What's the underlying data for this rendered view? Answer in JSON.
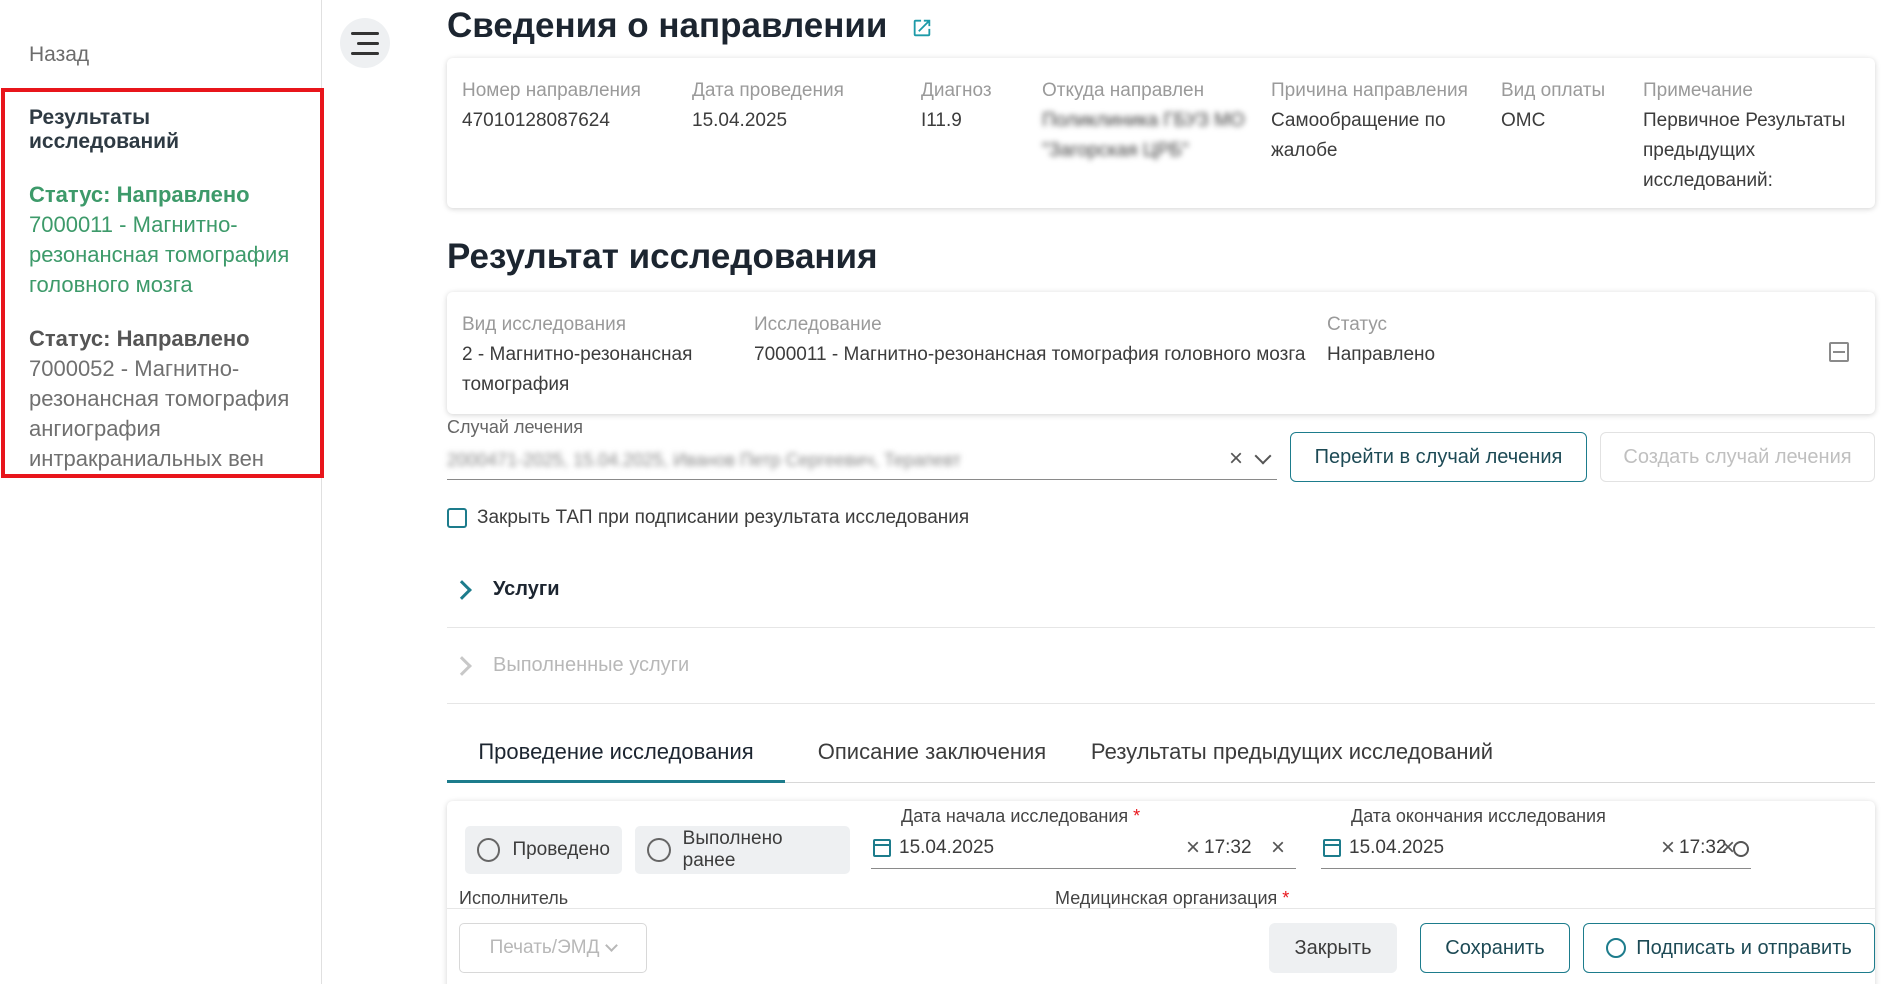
{
  "sidebar": {
    "back_label": "Назад",
    "results_title": "Результаты исследований",
    "items": [
      {
        "status": "Статус: Направлено",
        "name": "7000011 - Магнитно-резонансная томография головного мозга"
      },
      {
        "status": "Статус: Направлено",
        "name": "7000052 - Магнитно-резонансная томография ангиография интракраниальных вен"
      }
    ]
  },
  "referral": {
    "title": "Сведения о направлении",
    "number_label": "Номер направления",
    "number_value": "47010128087624",
    "date_label": "Дата проведения",
    "date_value": "15.04.2025",
    "diagnosis_label": "Диагноз",
    "diagnosis_value": "I11.9",
    "from_label": "Откуда направлен",
    "from_value": "Поликлиника ГБУЗ МО \"Загорская ЦРБ\"",
    "reason_label": "Причина направления",
    "reason_value": "Самообращение по жалобе",
    "payment_label": "Вид оплаты",
    "payment_value": "ОМС",
    "note_label": "Примечание",
    "note_value": "Первичное Результаты предыдущих исследований:"
  },
  "result": {
    "title": "Результат исследования",
    "type_label": "Вид исследования",
    "type_value": "2 - Магнитно-резонансная томография",
    "study_label": "Исследование",
    "study_value": "7000011 - Магнитно-резонансная томография головного мозга",
    "status_label": "Статус",
    "status_value": "Направлено"
  },
  "case": {
    "label": "Случай лечения",
    "value": "2000471-2025, 15.04.2025, Иванов Петр Сергеевич, Терапевт",
    "goto_button": "Перейти в случай лечения",
    "create_button": "Создать случай лечения"
  },
  "close_tap_label": "Закрыть ТАП при подписании результата исследования",
  "sections": {
    "services": "Услуги",
    "done_services": "Выполненные услуги"
  },
  "tabs": [
    "Проведение исследования",
    "Описание заключения",
    "Результаты предыдущих исследований"
  ],
  "conduct": {
    "radio_done": "Проведено",
    "radio_earlier": "Выполнено ранее",
    "start_label": "Дата начала исследования",
    "start_date": "15.04.2025",
    "start_time": "17:32",
    "end_label": "Дата окончания исследования",
    "end_date": "15.04.2025",
    "end_time": "17:32",
    "executor_label": "Исполнитель",
    "org_label": "Медицинская организация",
    "required_mark": "*"
  },
  "footer": {
    "print_label": "Печать/ЭМД",
    "close_label": "Закрыть",
    "save_label": "Сохранить",
    "sign_label": "Подписать и отправить"
  },
  "colors": {
    "accent": "#1d7c8c",
    "active_item": "#3d9a6a",
    "highlight_border": "#e8151b"
  }
}
